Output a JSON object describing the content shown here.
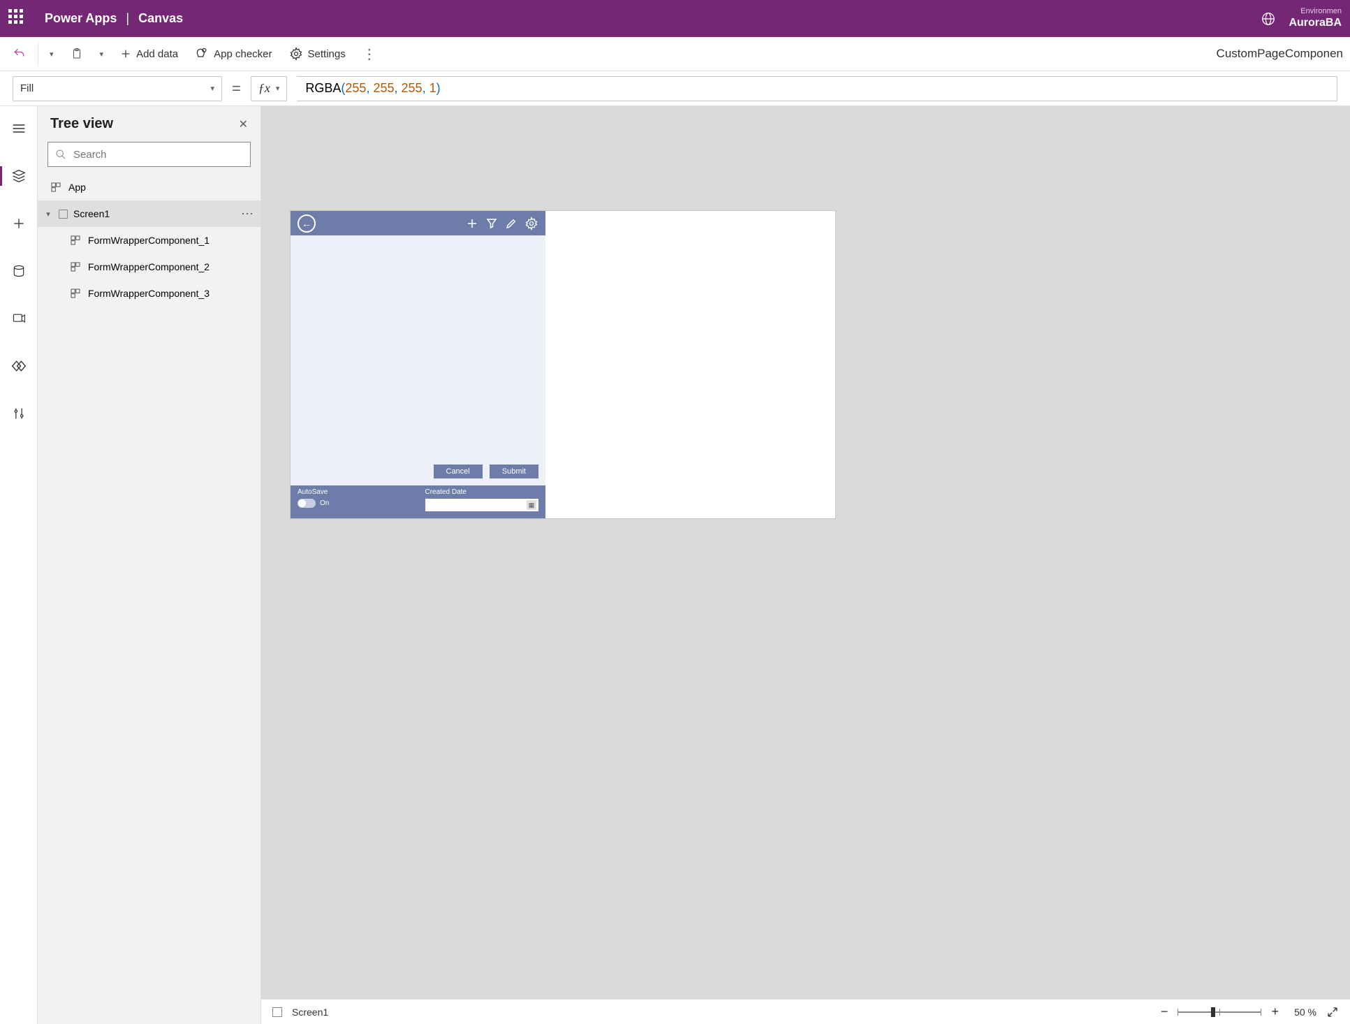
{
  "header": {
    "app_name": "Power Apps",
    "separator": "|",
    "page": "Canvas",
    "env_label": "Environmen",
    "env_name": "AuroraBA"
  },
  "cmdbar": {
    "add_data": "Add data",
    "app_checker": "App checker",
    "settings": "Settings",
    "right_title": "CustomPageComponen"
  },
  "formula_bar": {
    "property": "Fill",
    "formula_fn": "RGBA",
    "formula_args": [
      "255",
      "255",
      "255",
      "1"
    ]
  },
  "tree": {
    "title": "Tree view",
    "search_placeholder": "Search",
    "app_label": "App",
    "screen_label": "Screen1",
    "children": [
      "FormWrapperComponent_1",
      "FormWrapperComponent_2",
      "FormWrapperComponent_3"
    ]
  },
  "canvas_form": {
    "cancel": "Cancel",
    "submit": "Submit",
    "autosave_label": "AutoSave",
    "autosave_state": "On",
    "created_label": "Created Date"
  },
  "status": {
    "screen": "Screen1",
    "zoom_value": "50",
    "zoom_pct": "%"
  }
}
